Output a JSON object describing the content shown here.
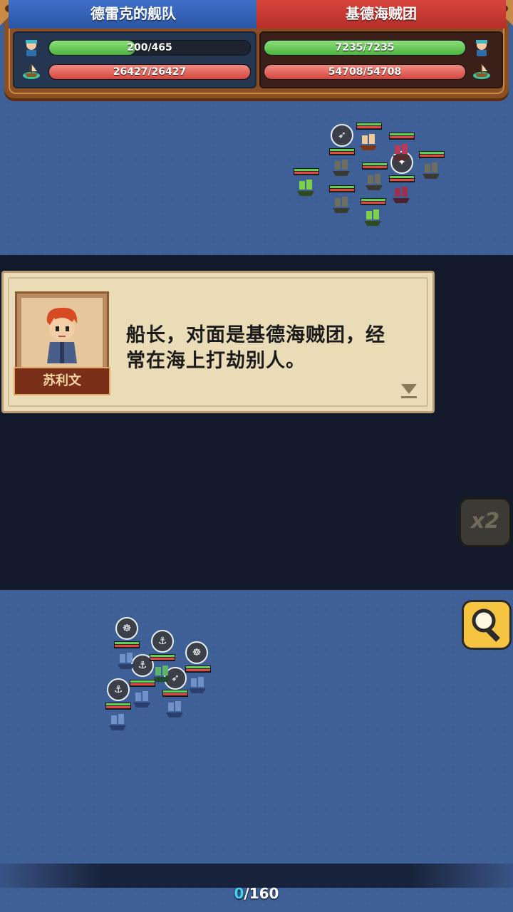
{
  "hud": {
    "left_team": {
      "name": "德雷克的舰队",
      "crew_bar": {
        "text": "200/465",
        "current": 200,
        "max": 465
      },
      "hull_bar": {
        "text": "26427/26427",
        "current": 26427,
        "max": 26427
      }
    },
    "right_team": {
      "name": "基德海贼团",
      "crew_bar": {
        "text": "7235/7235",
        "current": 7235,
        "max": 7235
      },
      "hull_bar": {
        "text": "54708/54708",
        "current": 54708,
        "max": 54708
      }
    },
    "icons": {
      "crew": "sailor-icon",
      "hull": "ship-icon"
    }
  },
  "dialog": {
    "speaker": "苏利文",
    "text_line1": "船长，对面是基德海贼团，经",
    "text_line2": "常在海上打劫别人。"
  },
  "controls": {
    "speed_label": "x2",
    "zoom_icon": "magnifier-icon"
  },
  "progress": {
    "current": "0",
    "total": "/160"
  },
  "colors": {
    "sea": "#3f5f97",
    "ally_header": "#2b55a4",
    "enemy_header": "#b52e2a",
    "hp_green": "#4cb33e",
    "hp_red": "#d4473f",
    "progress_accent": "#43d4f2"
  }
}
